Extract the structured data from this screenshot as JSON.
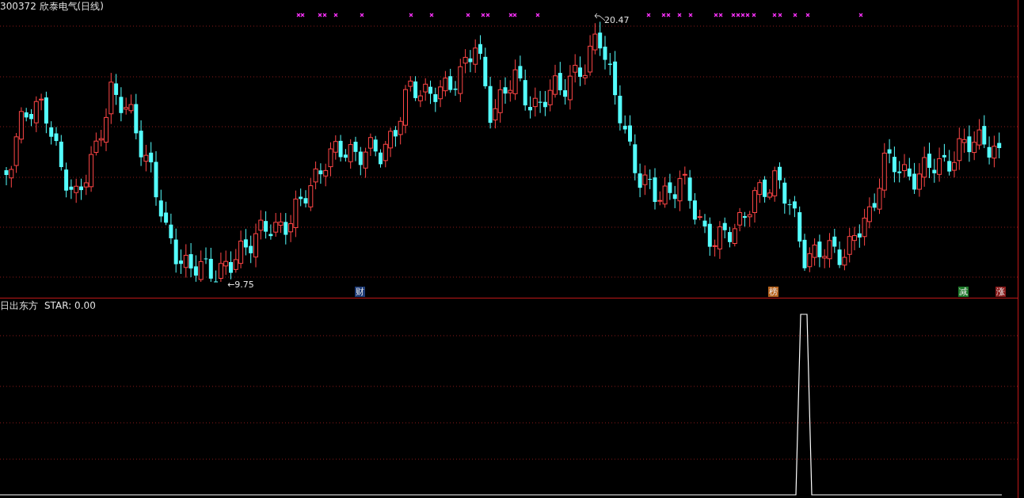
{
  "window": {
    "title": "300372 欣泰电气(日线)"
  },
  "price_chart": {
    "high_label": "20.47",
    "low_label": "←9.75",
    "markers": [
      {
        "text": "财",
        "color": "#1e3c78"
      },
      {
        "text": "榜",
        "color": "#b8641e"
      },
      {
        "text": "减",
        "color": "#1e7a2a"
      },
      {
        "text": "涨",
        "color": "#8a1a1a"
      }
    ]
  },
  "indicator": {
    "title": "日出东方",
    "reading": "STAR: 0.00"
  }
}
